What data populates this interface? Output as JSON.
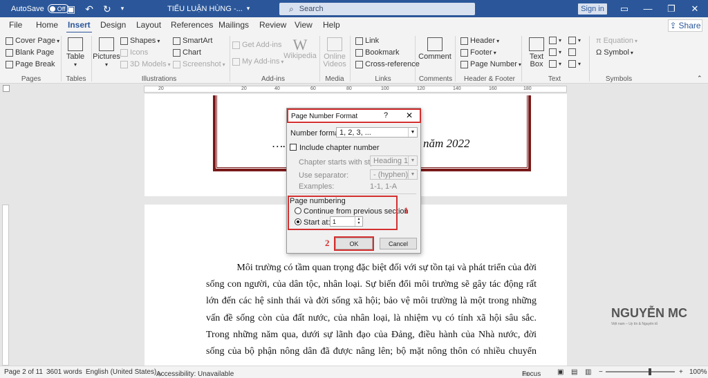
{
  "titlebar": {
    "autosave_label": "AutoSave",
    "autosave_state": "Off",
    "doc_title": "TIỂU LUẬN HÙNG -...",
    "search_placeholder": "Search",
    "signin": "Sign in"
  },
  "menu": {
    "tabs": [
      "File",
      "Home",
      "Insert",
      "Design",
      "Layout",
      "References",
      "Mailings",
      "Review",
      "View",
      "Help"
    ],
    "active": "Insert",
    "share": "Share"
  },
  "ribbon": {
    "pages": {
      "cover_page": "Cover Page",
      "blank_page": "Blank Page",
      "page_break": "Page Break",
      "group": "Pages"
    },
    "tables": {
      "table": "Table",
      "group": "Tables"
    },
    "illustrations": {
      "pictures": "Pictures",
      "shapes": "Shapes",
      "icons": "Icons",
      "models": "3D Models",
      "smartart": "SmartArt",
      "chart": "Chart",
      "screenshot": "Screenshot",
      "group": "Illustrations"
    },
    "addins": {
      "get": "Get Add-ins",
      "my": "My Add-ins",
      "wikipedia": "Wikipedia",
      "group": "Add-ins"
    },
    "media": {
      "online_videos_1": "Online",
      "online_videos_2": "Videos",
      "group": "Media"
    },
    "links": {
      "link": "Link",
      "bookmark": "Bookmark",
      "cross_reference": "Cross-reference",
      "group": "Links"
    },
    "comments": {
      "comment": "Comment",
      "group": "Comments"
    },
    "header_footer": {
      "header": "Header",
      "footer": "Footer",
      "page_number": "Page Number",
      "group": "Header & Footer"
    },
    "text": {
      "text_box_1": "Text",
      "text_box_2": "Box",
      "group": "Text"
    },
    "symbols": {
      "equation": "Equation",
      "symbol": "Symbol",
      "group": "Symbols"
    }
  },
  "ruler": {
    "marks": [
      "20",
      "20",
      "40",
      "60",
      "80",
      "100",
      "120",
      "140",
      "160",
      "180"
    ]
  },
  "document": {
    "date_prefix": "……",
    "date_suffix": "năm 2022",
    "lines": [
      "Môi trường có tầm quan trọng đặc biệt đối với sự tồn tại và phát triển của đời",
      "sống con người, của dân tộc, nhân loại. Sự biến đổi môi trường sẽ gây tác động rất",
      "lớn đến các hệ sinh thái và đời sống xã hội; bảo vệ môi trường là một trong những",
      "vấn đề sống còn của đất nước, của nhân loại, là nhiệm vụ có tính xã hội sâu sắc.",
      "Trong những năm qua, dưới sự lãnh đạo của Đảng, điều hành của Nhà nước, đời",
      "sống của bộ phận nông dân đã được nâng lên; bộ mặt nông thôn có nhiều chuyển"
    ]
  },
  "watermark": {
    "name": "NGUYỄN MC",
    "sub": "Việt nam – Uy tín & Nguyên tố"
  },
  "dialog": {
    "title": "Page Number Format",
    "help": "?",
    "close": "✕",
    "number_format_label": "Number format:",
    "number_format_value": "1, 2, 3, ...",
    "include_chapter": "Include chapter number",
    "chapter_style_label": "Chapter starts with style:",
    "chapter_style_value": "Heading 1",
    "separator_label": "Use separator:",
    "separator_value": "-   (hyphen)",
    "examples_label": "Examples:",
    "examples_value": "1-1, 1-A",
    "page_numbering": "Page numbering",
    "continue_label": "Continue from previous section",
    "start_at_label": "Start at:",
    "start_at_value": "1",
    "ok": "OK",
    "cancel": "Cancel"
  },
  "annotations": {
    "one": "1",
    "two": "2"
  },
  "status": {
    "page": "Page 2 of 11",
    "words": "3601 words",
    "language": "English (United States)",
    "accessibility": "Accessibility: Unavailable",
    "focus": "Focus",
    "zoom": "100%"
  },
  "colors": {
    "brand": "#2b579a",
    "annotation": "#d32f2f",
    "frame": "#7a1a1a"
  }
}
